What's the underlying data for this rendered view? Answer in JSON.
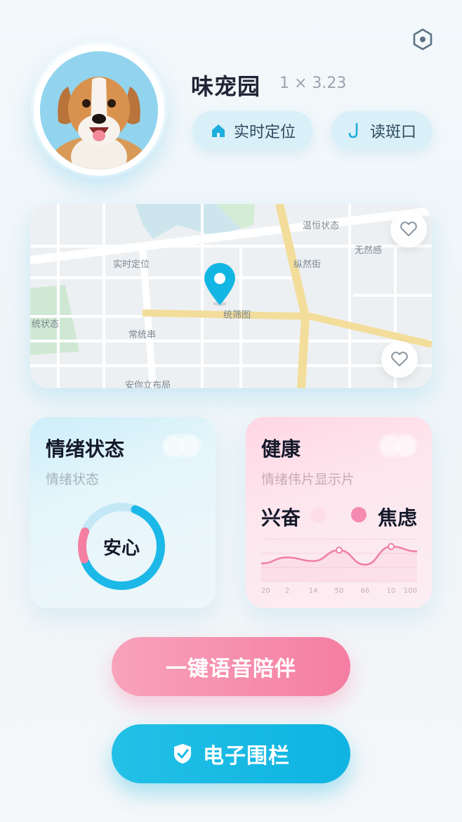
{
  "pet": {
    "name": "味宠园",
    "meta": "1 × 3.23"
  },
  "actions": {
    "locate_label": "实时定位",
    "read_label": "读斑口"
  },
  "map": {
    "labels": [
      "温恒状态",
      "无然感",
      "实时定位",
      "统筛图",
      "常统串",
      "统状态",
      "安你立布局",
      "纵然街"
    ]
  },
  "mood_card": {
    "title": "情绪状态",
    "subtitle": "情绪状态",
    "value": "安心"
  },
  "health_card": {
    "title": "健康",
    "subtitle": "情绪伟片显示片",
    "legend": [
      {
        "label": "兴奋",
        "color": "#fcdde8"
      },
      {
        "label": "焦虑",
        "color": "#f58bb0"
      }
    ]
  },
  "chart_data": {
    "type": "line",
    "x": [
      "20",
      "2",
      "14",
      "50",
      "66",
      "10",
      "100"
    ],
    "series": [
      {
        "values": [
          30,
          40,
          34,
          52,
          28,
          58,
          50
        ]
      }
    ],
    "ylim": [
      0,
      70
    ],
    "grid": true
  },
  "buttons": {
    "voice_label": "一键语音陪伴",
    "fence_label": "电子围栏"
  },
  "colors": {
    "accent_blue": "#13b6e3",
    "accent_pink": "#f57ea3",
    "mood_ring_blue": "#1bb8e8",
    "mood_ring_pink": "#f57ea3"
  },
  "icons": {
    "settings": "hexagon-gear-icon",
    "locate": "house-icon",
    "read": "hook-icon",
    "favorite": "heart-icon",
    "pin": "map-pin-icon",
    "fence": "shield-check-icon"
  }
}
